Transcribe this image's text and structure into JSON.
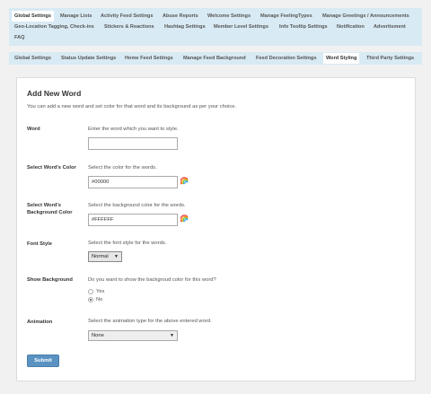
{
  "nav_top": {
    "items": [
      "Global Settings",
      "Manage Lists",
      "Activity Feed Settings",
      "Abuse Reports",
      "Welcome Settings",
      "Manage FeelingTypes",
      "Manage Greetings / Announcements",
      "Geo-Location Tagging, Check-ins",
      "Stickers & Reactions",
      "Hashtag Settings",
      "Member Level Settings",
      "Info Tooltip Settings",
      "Notification",
      "Advertisment",
      "FAQ"
    ]
  },
  "nav_sub": {
    "items": [
      "Global Settings",
      "Status Update Settings",
      "Home Feed Settings",
      "Manage Feed Background",
      "Feed Decoration Settings",
      "Word Styling",
      "Third Party Settings"
    ]
  },
  "form": {
    "title": "Add New Word",
    "description": "You can add a new word and set color for that word and its background as per your choice.",
    "word": {
      "label": "Word",
      "hint": "Enter the word which you want to style.",
      "value": ""
    },
    "word_color": {
      "label": "Select Word's Color",
      "hint": "Select the color for the words.",
      "value": "#00000"
    },
    "bg_color": {
      "label": "Select Word's Background Color",
      "hint": "Select the background color for the words.",
      "value": "#FFFFFF"
    },
    "font_style": {
      "label": "Font Style",
      "hint": "Select the font style for the words.",
      "value": "Normal"
    },
    "show_bg": {
      "label": "Show Background",
      "hint": "Do you want to show the backgroud color for this word?",
      "yes": "Yes",
      "no": "No",
      "selected": "No"
    },
    "animation": {
      "label": "Animation",
      "hint": "Select the animation type for the above entered word.",
      "value": "None"
    },
    "submit": "Submit"
  }
}
